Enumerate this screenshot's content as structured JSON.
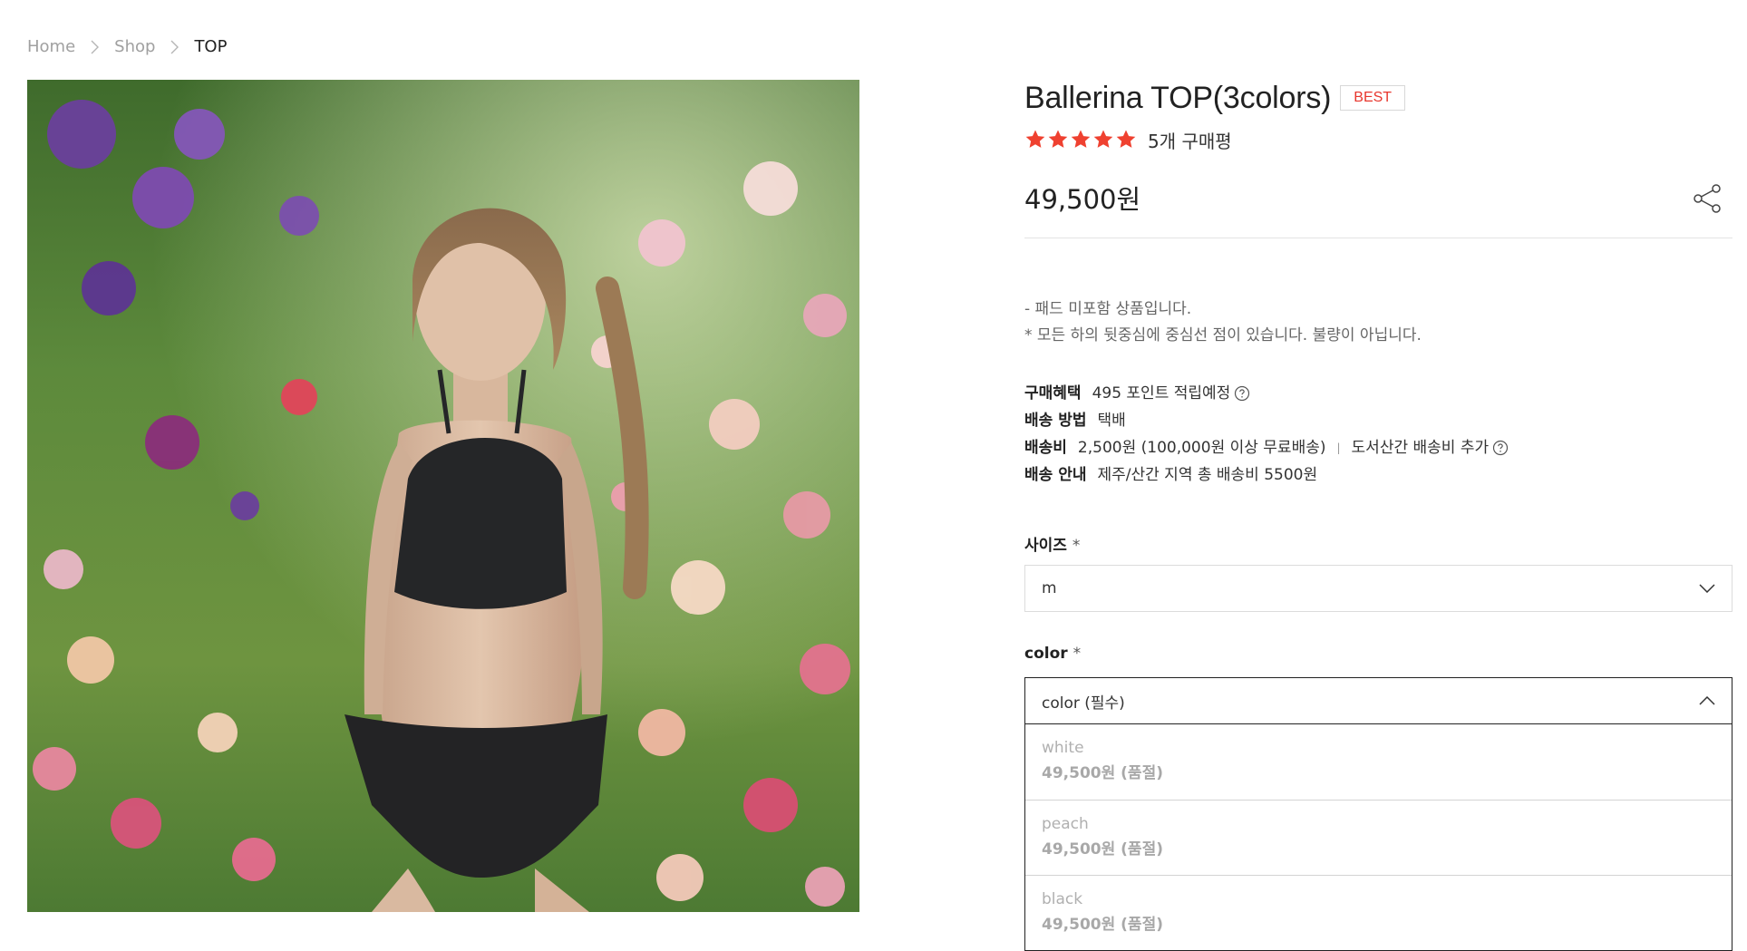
{
  "breadcrumb": {
    "home": "Home",
    "shop": "Shop",
    "current": "TOP"
  },
  "product": {
    "title": "Ballerina TOP(3colors)",
    "badge": "BEST",
    "rating_stars": 5,
    "review_count": "5개 구매평",
    "price": "49,500원",
    "notes": [
      "- 패드 미포함 상품입니다.",
      "* 모든 하의 뒷중심에 중심선 점이 있습니다. 불량이 아닙니다."
    ]
  },
  "benefits": {
    "purchase_label": "구매혜택",
    "purchase_value": "495 포인트 적립예정",
    "method_label": "배송 방법",
    "method_value": "택배",
    "fee_label": "배송비",
    "fee_value": "2,500원 (100,000원 이상 무료배송)",
    "fee_extra": "도서산간 배송비 추가",
    "guide_label": "배송 안내",
    "guide_value": "제주/산간 지역 총 배송비 5500원"
  },
  "options": {
    "size": {
      "label": "사이즈",
      "required_mark": "*",
      "selected": "m"
    },
    "color": {
      "label": "color",
      "required_mark": "*",
      "placeholder": "color (필수)",
      "items": [
        {
          "name": "white",
          "price": "49,500원 (품절)"
        },
        {
          "name": "peach",
          "price": "49,500원 (품절)"
        },
        {
          "name": "black",
          "price": "49,500원 (품절)"
        }
      ]
    }
  },
  "colors": {
    "accent_red": "#e8362d",
    "star_red": "#ef4130",
    "badge_border": "#d8d8d8"
  },
  "icons": [
    "chevron-right-icon",
    "star-icon",
    "share-icon",
    "help-circle-icon",
    "chevron-down-icon",
    "chevron-up-icon"
  ]
}
